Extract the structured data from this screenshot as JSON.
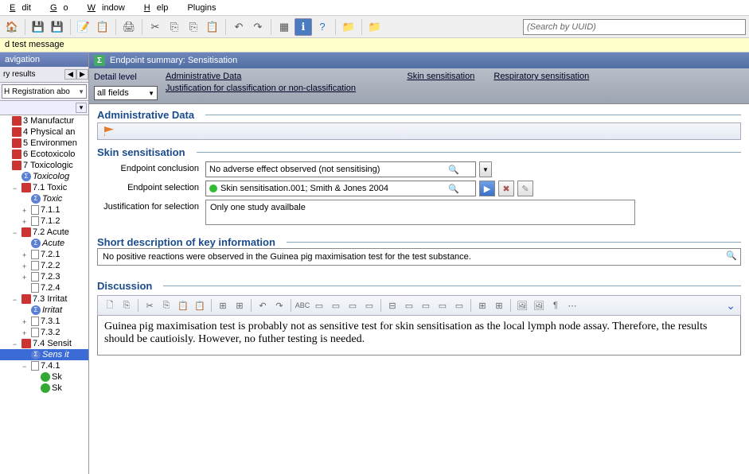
{
  "menu": {
    "edit": "Edit",
    "go": "Go",
    "window": "Window",
    "help": "Help",
    "plugins": "Plugins"
  },
  "search": {
    "placeholder": "(Search by UUID)"
  },
  "message_bar": "d test message",
  "nav": {
    "title": "avigation",
    "tab": "ry results",
    "sub_combo": "H Registration abo"
  },
  "tree": [
    {
      "indent": 0,
      "icon": "red",
      "label": "3 Manufactur"
    },
    {
      "indent": 0,
      "icon": "red",
      "label": "4 Physical an"
    },
    {
      "indent": 0,
      "icon": "red",
      "label": "5 Environmen"
    },
    {
      "indent": 0,
      "icon": "red",
      "label": "6 Ecotoxicolo"
    },
    {
      "indent": 0,
      "icon": "red",
      "label": "7 Toxicologic"
    },
    {
      "indent": 1,
      "icon": "blue",
      "label": "Toxicolog"
    },
    {
      "indent": 1,
      "icon": "red",
      "label": "7.1 Toxic",
      "toggle": "−"
    },
    {
      "indent": 2,
      "icon": "blue",
      "label": "Toxic"
    },
    {
      "indent": 2,
      "icon": "doc",
      "label": "7.1.1",
      "toggle": "+"
    },
    {
      "indent": 2,
      "icon": "doc",
      "label": "7.1.2",
      "toggle": "+"
    },
    {
      "indent": 1,
      "icon": "red",
      "label": "7.2 Acute",
      "toggle": "−"
    },
    {
      "indent": 2,
      "icon": "blue",
      "label": "Acute"
    },
    {
      "indent": 2,
      "icon": "doc",
      "label": "7.2.1",
      "toggle": "+"
    },
    {
      "indent": 2,
      "icon": "doc",
      "label": "7.2.2",
      "toggle": "+"
    },
    {
      "indent": 2,
      "icon": "doc",
      "label": "7.2.3",
      "toggle": "+"
    },
    {
      "indent": 2,
      "icon": "doc",
      "label": "7.2.4"
    },
    {
      "indent": 1,
      "icon": "red",
      "label": "7.3 Irritat",
      "toggle": "−"
    },
    {
      "indent": 2,
      "icon": "blue",
      "label": "Irritat"
    },
    {
      "indent": 2,
      "icon": "doc",
      "label": "7.3.1",
      "toggle": "+"
    },
    {
      "indent": 2,
      "icon": "doc",
      "label": "7.3.2",
      "toggle": "+"
    },
    {
      "indent": 1,
      "icon": "red",
      "label": "7.4 Sensit",
      "toggle": "−"
    },
    {
      "indent": 2,
      "icon": "blue",
      "label": "Sens it",
      "selected": true
    },
    {
      "indent": 2,
      "icon": "doc",
      "label": "7.4.1",
      "toggle": "−"
    },
    {
      "indent": 3,
      "icon": "green",
      "label": "Sk"
    },
    {
      "indent": 3,
      "icon": "green",
      "label": "Sk"
    }
  ],
  "header": {
    "title": "Endpoint summary: Sensitisation"
  },
  "detail": {
    "label": "Detail level",
    "value": "all fields",
    "links": {
      "admin": "Administrative Data",
      "skin": "Skin sensitisation",
      "resp": "Respiratory sensitisation",
      "just": "Justification for classification or non-classification"
    }
  },
  "sections": {
    "admin_title": "Administrative Data",
    "skin_title": "Skin sensitisation",
    "endpoint_concl_label": "Endpoint conclusion",
    "endpoint_concl_value": "No adverse effect observed (not sensitising)",
    "endpoint_sel_label": "Endpoint selection",
    "endpoint_sel_value": "Skin sensitisation.001; Smith & Jones 2004",
    "just_sel_label": "Justification for selection",
    "just_sel_value": "Only one study availbale",
    "short_desc_title": "Short description of key information",
    "short_desc_value": "No positive reactions were observed in the Guinea pig maximisation test for the test substance.",
    "discussion_title": "Discussion",
    "discussion_value": "Guinea pig maximisation test is probably not as sensitive test for skin sensitisation as the local lymph node assay. Therefore, the results should be cautioisly. However, no futher testing is needed."
  }
}
